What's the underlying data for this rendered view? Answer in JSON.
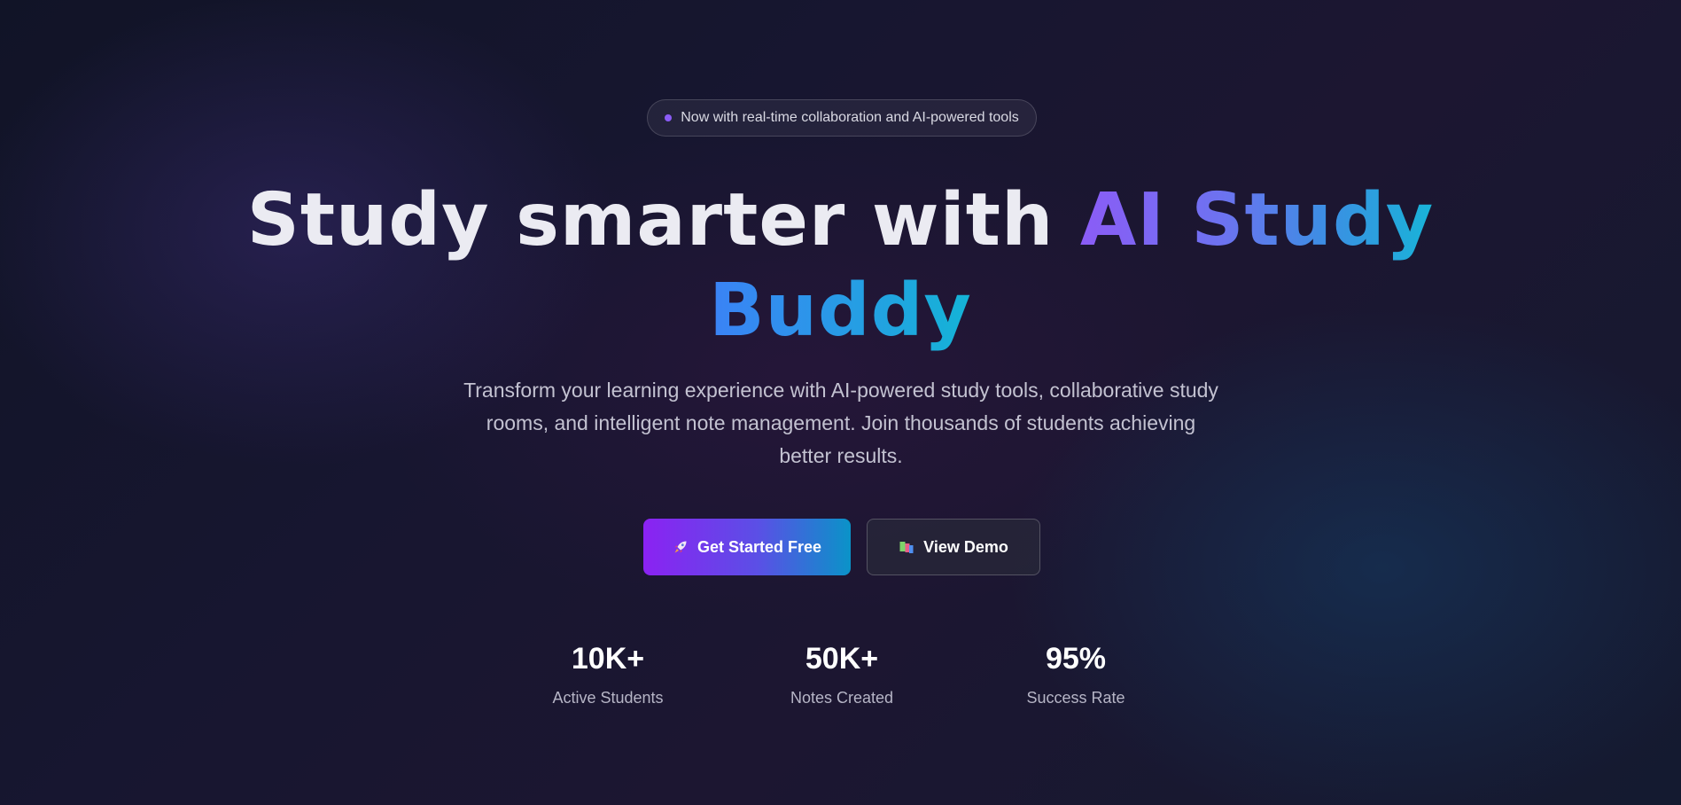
{
  "badge": {
    "text": "Now with real-time collaboration and AI-powered tools"
  },
  "headline": {
    "plain": "Study smarter with ",
    "gradient_line1": "AI Study",
    "gradient_line2": "Buddy"
  },
  "subtitle": "Transform your learning experience with AI-powered study tools, collaborative study rooms, and intelligent note management. Join thousands of students achieving better results.",
  "buttons": {
    "primary": {
      "label": "Get Started Free",
      "icon": "rocket-icon"
    },
    "secondary": {
      "label": "View Demo",
      "icon": "books-icon"
    }
  },
  "stats": [
    {
      "value": "10K+",
      "label": "Active Students"
    },
    {
      "value": "50K+",
      "label": "Notes Created"
    },
    {
      "value": "95%",
      "label": "Success Rate"
    }
  ],
  "colors": {
    "background": "#151630",
    "accent_purple": "#8b5cf6",
    "accent_cyan": "#14b4d6",
    "text_primary": "#ebebf2",
    "text_secondary": "#c3c2d1"
  }
}
